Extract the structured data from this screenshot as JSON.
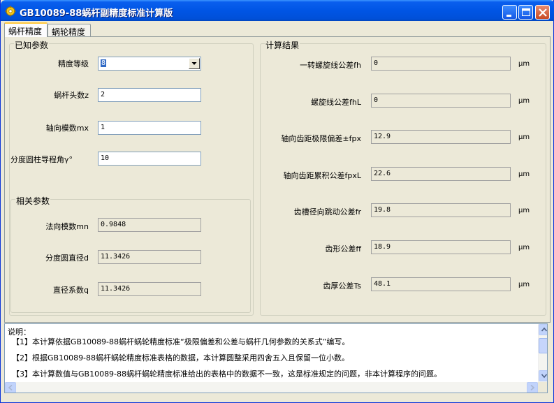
{
  "window": {
    "title": "GB10089-88蜗杆副精度标准计算版"
  },
  "tabs": [
    {
      "label": "蜗杆精度",
      "active": true
    },
    {
      "label": "蜗轮精度",
      "active": false
    }
  ],
  "known": {
    "title": "已知参数",
    "precision_label": "精度等级",
    "precision_value": "8",
    "heads_label": "蜗杆头数z",
    "heads_value": "2",
    "axial_module_label": "轴向模数mx",
    "axial_module_value": "1",
    "lead_angle_label": "分度圆柱导程角γ°",
    "lead_angle_value": "10"
  },
  "related": {
    "title": "相关参数",
    "normal_module_label": "法向模数mn",
    "normal_module_value": "0.9848",
    "pitch_dia_label": "分度圆直径d",
    "pitch_dia_value": "11.3426",
    "dia_factor_label": "直径系数q",
    "dia_factor_value": "11.3426"
  },
  "results": {
    "title": "计算结果",
    "unit": "μm",
    "items": [
      {
        "label": "一转螺旋线公差fh",
        "value": "0"
      },
      {
        "label": "螺旋线公差fhL",
        "value": "0"
      },
      {
        "label": "轴向齿距极限偏差±fpx",
        "value": "12.9"
      },
      {
        "label": "轴向齿距累积公差fpxL",
        "value": "22.6"
      },
      {
        "label": "齿槽径向跳动公差fr",
        "value": "19.8"
      },
      {
        "label": "齿形公差ff",
        "value": "18.9"
      },
      {
        "label": "齿厚公差Ts",
        "value": "48.1"
      }
    ]
  },
  "notes": {
    "heading": "说明：",
    "lines": [
      "【1】本计算依据GB10089-88蜗杆蜗轮精度标准“极限偏差和公差与蜗杆几何参数的关系式”编写。",
      "【2】根据GB10089-88蜗杆蜗轮精度标准表格的数据，本计算圆整采用四舍五入且保留一位小数。",
      "【3】本计算数值与GB10089-88蜗杆蜗轮精度标准给出的表格中的数据不一致，这是标准规定的问题，非本计算程序的问题。"
    ]
  },
  "colors": {
    "titlebar": "#0055E5",
    "face": "#ECE9D8",
    "selection": "#316AC5"
  }
}
